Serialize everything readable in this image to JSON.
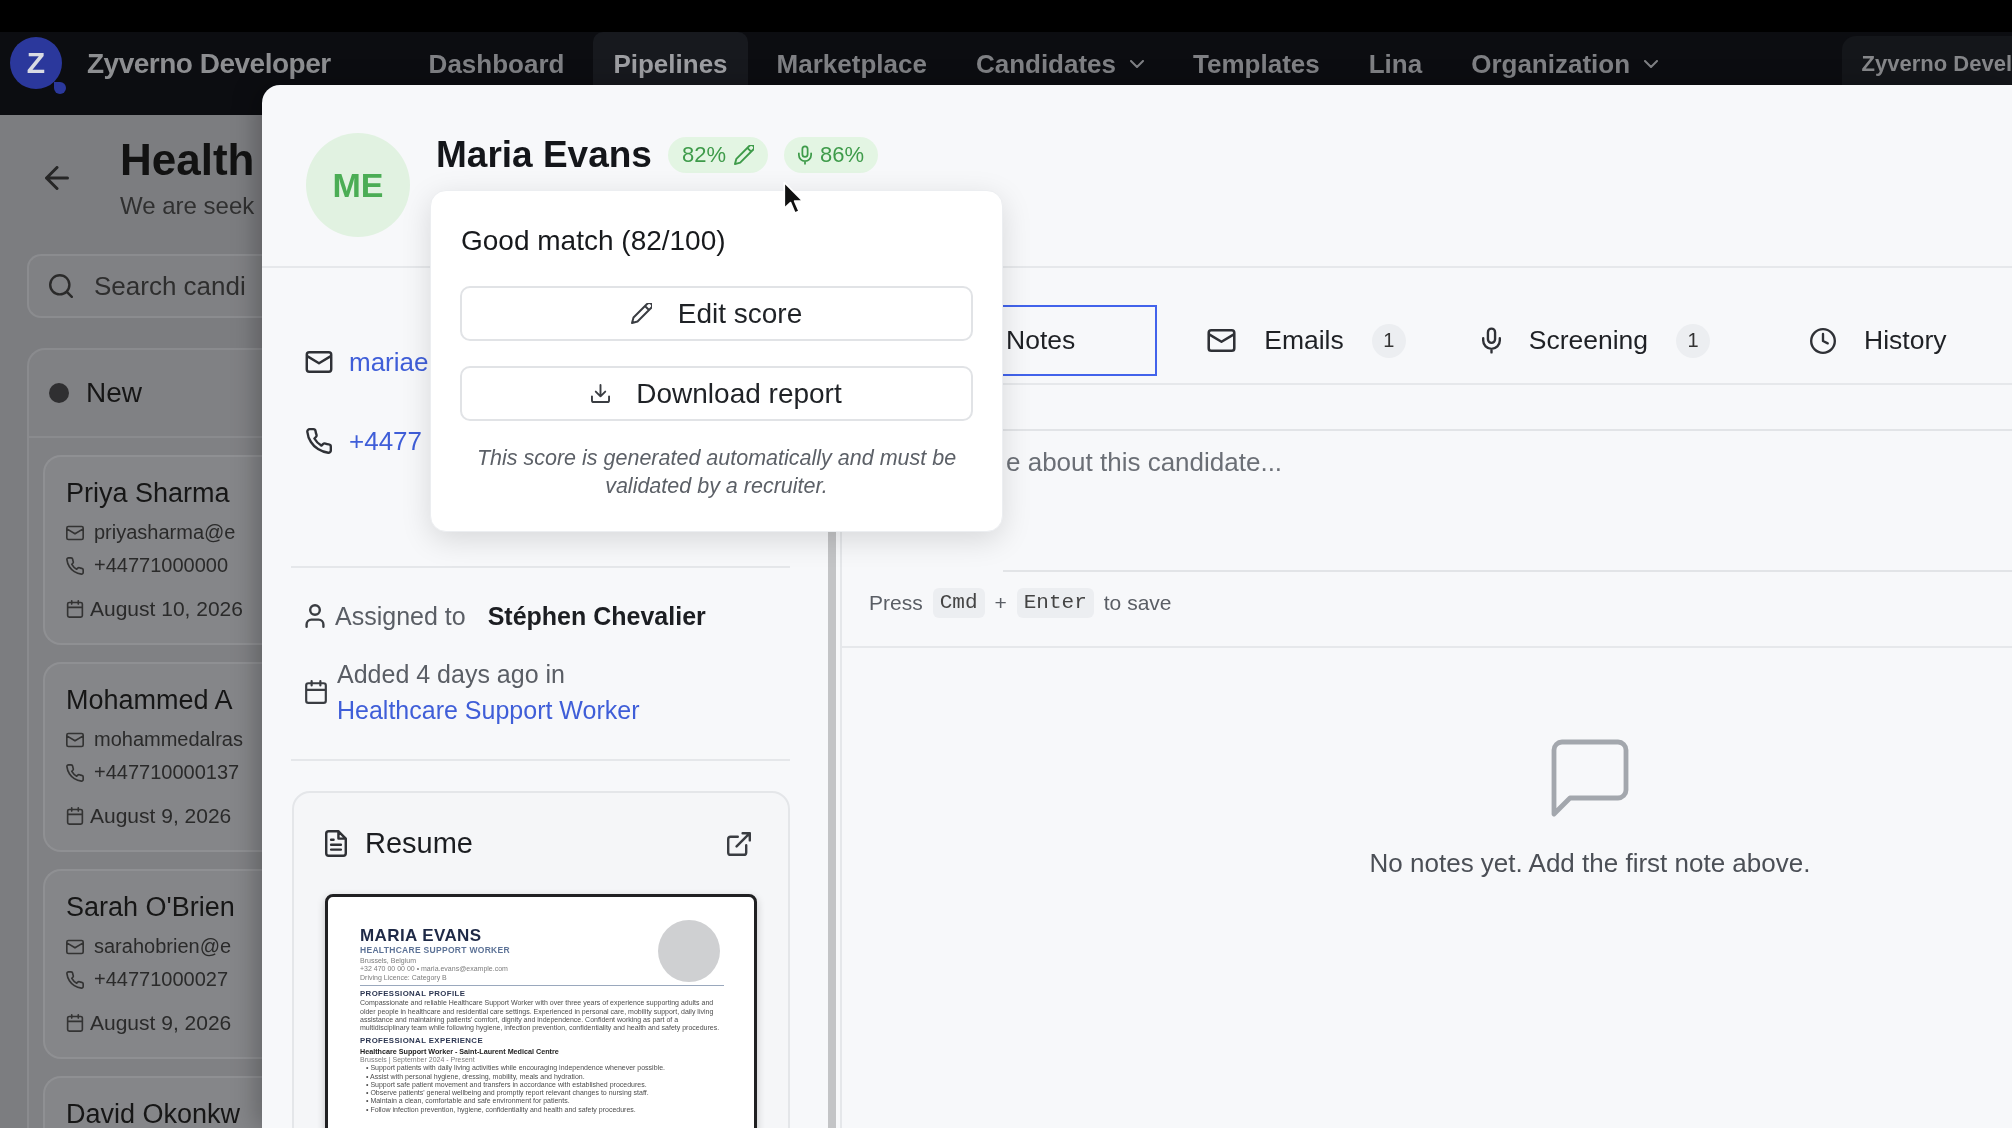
{
  "nav": {
    "logo_letter": "Z",
    "brand": "Zyverno Developer",
    "items": [
      {
        "label": "Dashboard",
        "selected": false,
        "dropdown": false
      },
      {
        "label": "Pipelines",
        "selected": true,
        "dropdown": false
      },
      {
        "label": "Marketplace",
        "selected": false,
        "dropdown": false
      },
      {
        "label": "Candidates",
        "selected": false,
        "dropdown": true
      },
      {
        "label": "Templates",
        "selected": false,
        "dropdown": false
      },
      {
        "label": "Lina",
        "selected": false,
        "dropdown": false
      },
      {
        "label": "Organization",
        "selected": false,
        "dropdown": true
      }
    ],
    "account": "Zyverno Devel"
  },
  "pipeline_page": {
    "title": "Health",
    "subtitle": "We are seek",
    "search": {
      "placeholder": "Search candi"
    },
    "column": {
      "name": "New",
      "cards": [
        {
          "name": "Priya Sharma",
          "email": "priyasharma@e",
          "phone": "+44771000000",
          "date": "August 10, 2026"
        },
        {
          "name": "Mohammed A",
          "email": "mohammedalras",
          "phone": "+447710000137",
          "date": "August 9, 2026"
        },
        {
          "name": "Sarah O'Brien",
          "email": "sarahobrien@e",
          "phone": "+44771000027",
          "date": "August 9, 2026"
        },
        {
          "name": "David Okonkw"
        }
      ]
    }
  },
  "candidate": {
    "initials": "ME",
    "name": "Maria Evans",
    "match_score": "82%",
    "screening_score": "86%",
    "contacts": [
      {
        "kind": "email",
        "value": "mariae"
      },
      {
        "kind": "phone",
        "value": "+4477"
      }
    ],
    "assigned_label": "Assigned to",
    "assignee": "Stéphen Chevalier",
    "added_text": "Added 4 days ago in",
    "added_link": "Healthcare Support Worker",
    "resume": {
      "title": "Resume",
      "document": {
        "name": "MARIA EVANS",
        "role": "HEALTHCARE SUPPORT WORKER",
        "contact_lines": [
          "Brussels, Belgium",
          "+32 470 00 00 00 • maria.evans@example.com",
          "Driving Licence: Category B"
        ],
        "sections": [
          {
            "kind": "profile",
            "heading": "PROFESSIONAL PROFILE",
            "text": "Compassionate and reliable Healthcare Support Worker with over three years of experience supporting adults and older people in healthcare and residential care settings. Experienced in personal care, mobility support, daily living assistance and maintaining patients' comfort, dignity and independence. Confident working as part of a multidisciplinary team while following hygiene, infection prevention, confidentiality and health and safety procedures."
          },
          {
            "kind": "experience",
            "heading": "PROFESSIONAL EXPERIENCE",
            "job_title": "Healthcare Support Worker - Saint-Laurent Medical Centre",
            "job_meta": "Brussels | September 2024 - Present",
            "bullets": [
              "• Support patients with daily living activities while encouraging independence whenever possible.",
              "• Assist with personal hygiene, dressing, mobility, meals and hydration.",
              "• Support safe patient movement and transfers in accordance with established procedures.",
              "• Observe patients' general wellbeing and promptly report relevant changes to nursing staff.",
              "• Maintain a clean, comfortable and safe environment for patients.",
              "• Follow infection prevention, hygiene, confidentiality and health and safety procedures."
            ]
          }
        ]
      }
    }
  },
  "score_popover": {
    "title": "Good match (82/100)",
    "buttons": [
      {
        "kind": "edit",
        "label": "Edit score"
      },
      {
        "kind": "download",
        "label": "Download report"
      }
    ],
    "disclaimer": "This score is generated automatically and must be validated by a recruiter."
  },
  "tabs": [
    {
      "kind": "notes",
      "label": "Notes",
      "selected": true
    },
    {
      "kind": "emails",
      "label": "Emails",
      "count": "1",
      "selected": false
    },
    {
      "kind": "screening",
      "label": "Screening",
      "count": "1",
      "selected": false
    },
    {
      "kind": "history",
      "label": "History",
      "selected": false
    }
  ],
  "note_field": {
    "placeholder": "e about this candidate..."
  },
  "save_hint": {
    "prefix": "Press",
    "keys": [
      "Cmd",
      "Enter"
    ],
    "separator": "+",
    "suffix": "to save"
  },
  "empty_state": "No notes yet. Add the first note above."
}
